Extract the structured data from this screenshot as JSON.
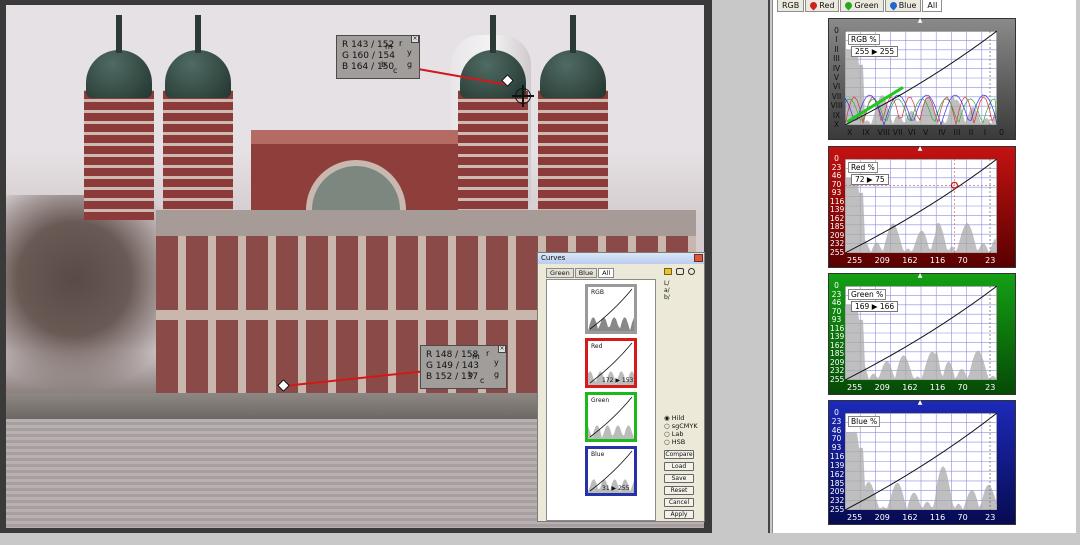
{
  "samplers": [
    {
      "rows": [
        "R 143 / 152",
        "G 160 / 154",
        "B 164 / 150"
      ]
    },
    {
      "rows": [
        "R 148 / 158",
        "G 149 / 143",
        "B 152 / 137"
      ]
    }
  ],
  "wheel_letters": {
    "r": "r",
    "m": "m",
    "y": "y",
    "b": "b",
    "g": "g",
    "c": "c"
  },
  "curves_window": {
    "title": "Curves",
    "tabs": [
      "Green",
      "Blue",
      "All"
    ],
    "minis": [
      {
        "label": "RGB",
        "color": "#9a9a9a",
        "value": ""
      },
      {
        "label": "Red",
        "color": "#d61a1a",
        "value": "172 ▶ 153"
      },
      {
        "label": "Green",
        "color": "#1cb81c",
        "value": ""
      },
      {
        "label": "Blue",
        "color": "#2632a8",
        "value": "31 ▶ 255"
      }
    ],
    "lab": [
      "L/",
      "a/",
      "b/"
    ],
    "modes": [
      "Hild",
      "sgCMYK",
      "Lab",
      "HSB"
    ],
    "buttons": [
      "Compare",
      "Load",
      "Save",
      "Reset",
      "Cancel",
      "Apply"
    ]
  },
  "right_tabs": [
    {
      "label": "RGB",
      "icon": ""
    },
    {
      "label": "Red",
      "icon": "#cc2222"
    },
    {
      "label": "Green",
      "icon": "#22aa22"
    },
    {
      "label": "Blue",
      "icon": "#2266cc"
    },
    {
      "label": "All",
      "icon": ""
    }
  ],
  "curves": [
    {
      "id": "rgb",
      "label": "RGB %",
      "point": "255 ▶ 255",
      "bg": "#8a8a8a",
      "bg2": "#3a3a3a",
      "labelColor": "#111",
      "y_ticks": [
        "0",
        "I",
        "II",
        "III",
        "IV",
        "V",
        "VI",
        "VII",
        "VIII",
        "IX",
        "X"
      ],
      "x_ticks": [
        "X",
        "IX",
        "VIII",
        "VII",
        "VI",
        "V",
        "IV",
        "III",
        "II",
        "I",
        "0"
      ]
    },
    {
      "id": "red",
      "label": "Red %",
      "point": "72 ▶ 75",
      "bg": "#c41212",
      "bg2": "#5a0000",
      "labelColor": "#fff",
      "y_ticks": [
        "0",
        "23",
        "46",
        "70",
        "93",
        "116",
        "139",
        "162",
        "185",
        "209",
        "232",
        "255"
      ],
      "x_ticks": [
        "255",
        "209",
        "162",
        "116",
        "70",
        "23"
      ]
    },
    {
      "id": "green",
      "label": "Green %",
      "point": "169 ▶ 166",
      "bg": "#14a014",
      "bg2": "#064a06",
      "labelColor": "#fff",
      "y_ticks": [
        "0",
        "23",
        "46",
        "70",
        "93",
        "116",
        "139",
        "162",
        "185",
        "209",
        "232",
        "255"
      ],
      "x_ticks": [
        "255",
        "209",
        "162",
        "116",
        "70",
        "23"
      ]
    },
    {
      "id": "blue",
      "label": "Blue %",
      "point": "",
      "bg": "#1c2ab8",
      "bg2": "#070b52",
      "labelColor": "#fff",
      "y_ticks": [
        "0",
        "23",
        "46",
        "70",
        "93",
        "116",
        "139",
        "162",
        "185",
        "209",
        "232",
        "255"
      ],
      "x_ticks": [
        "255",
        "209",
        "162",
        "116",
        "70",
        "23"
      ]
    }
  ]
}
